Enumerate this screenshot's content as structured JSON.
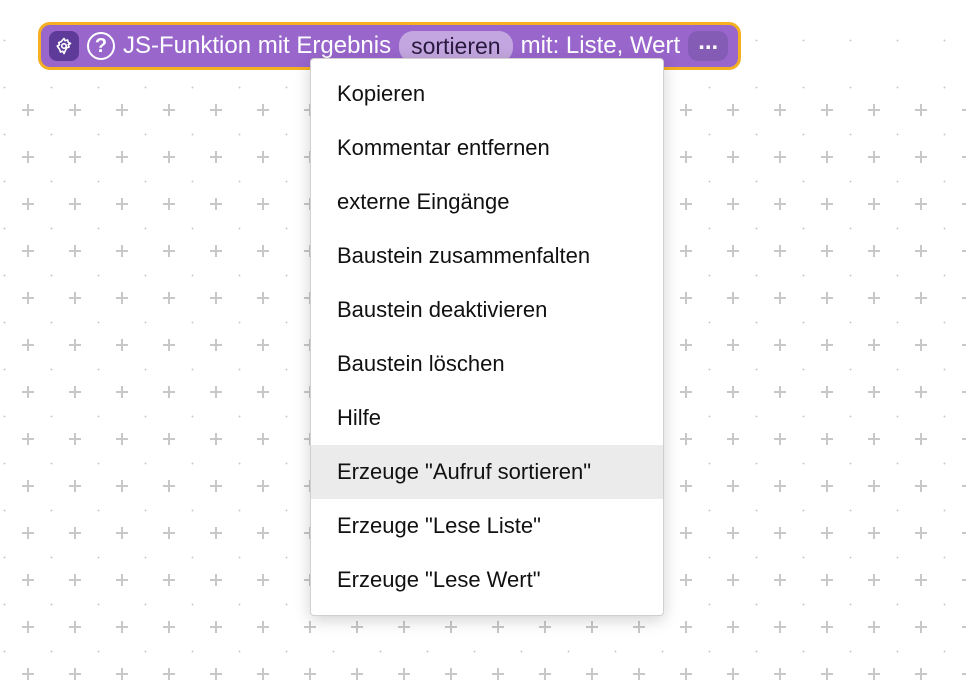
{
  "block": {
    "prefix": "JS-Funktion mit Ergebnis",
    "function_name": "sortieren",
    "params_label": "mit: Liste, Wert",
    "more": "..."
  },
  "menu": {
    "items": [
      "Kopieren",
      "Kommentar entfernen",
      "externe Eingänge",
      "Baustein zusammenfalten",
      "Baustein deaktivieren",
      "Baustein löschen",
      "Hilfe",
      "Erzeuge \"Aufruf sortieren\"",
      "Erzeuge \"Lese Liste\"",
      "Erzeuge \"Lese Wert\""
    ],
    "hovered_index": 7
  }
}
